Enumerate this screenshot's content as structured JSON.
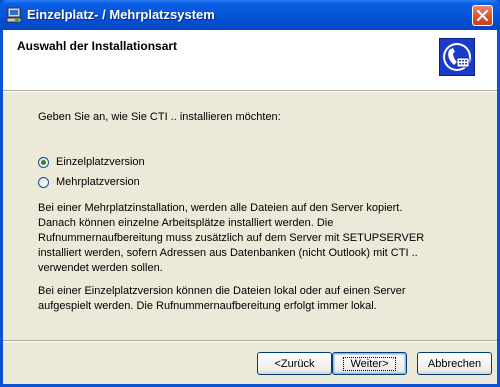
{
  "window": {
    "title": "Einzelplatz- / Mehrplatzsystem"
  },
  "header": {
    "title": "Auswahl der Installationsart"
  },
  "main": {
    "prompt": "Geben Sie an, wie Sie CTI .. installieren möchten:",
    "options": [
      {
        "label": "Einzelplatzversion",
        "selected": true
      },
      {
        "label": "Mehrplatzversion",
        "selected": false
      }
    ],
    "paragraph1": "Bei einer Mehrplatzinstallation, werden alle Dateien auf den Server kopiert.\nDanach können einzelne Arbeitsplätze installiert werden. Die\nRufnummernaufbereitung muss zusätzlich auf dem Server mit SETUPSERVER\ninstalliert werden, sofern Adressen aus Datenbanken (nicht Outlook) mit CTI ..\nverwendet werden sollen.",
    "paragraph2": "Bei einer Einzelplatzversion können die Dateien lokal oder auf einen Server\naufgespielt werden. Die Rufnummernaufbereitung erfolgt immer lokal."
  },
  "buttons": {
    "back": "<Zurück",
    "next": "Weiter>",
    "cancel": "Abbrechen"
  },
  "colors": {
    "titlebar": "#0552d6",
    "dialog_bg": "#ece9d8",
    "close_button": "#d9502c",
    "logo_blue": "#1a3cc8"
  },
  "icons": {
    "title": "setup-computer-icon",
    "close": "close-icon",
    "logo": "telephone-card-icon"
  }
}
